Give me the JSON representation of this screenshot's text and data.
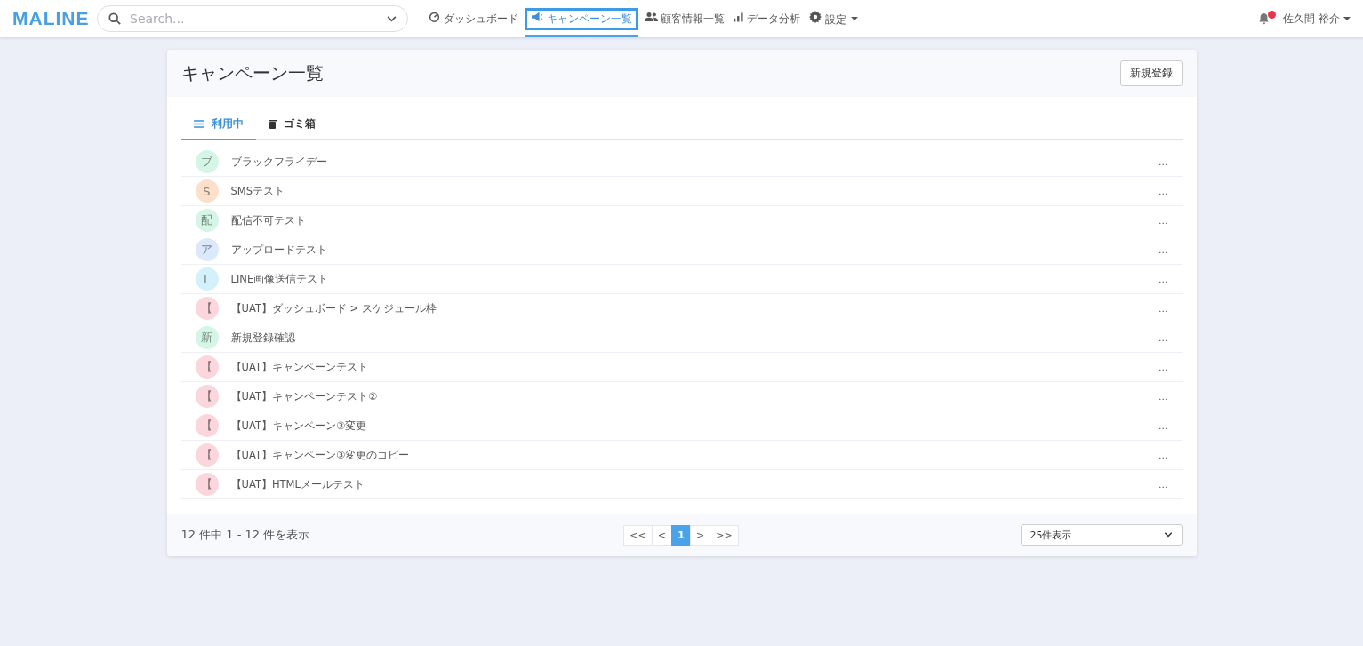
{
  "header": {
    "logo": "MALINE",
    "search": {
      "placeholder": "Search..."
    },
    "nav": [
      {
        "label": "ダッシュボード",
        "selected": false,
        "dropdown": false
      },
      {
        "label": "キャンペーン一覧",
        "selected": true,
        "dropdown": false
      },
      {
        "label": "顧客情報一覧",
        "selected": false,
        "dropdown": false
      },
      {
        "label": "データ分析",
        "selected": false,
        "dropdown": false
      },
      {
        "label": "設定",
        "selected": false,
        "dropdown": true
      }
    ],
    "notification": {
      "unread": true
    },
    "user": "佐久間 裕介"
  },
  "page": {
    "title": "キャンペーン一覧",
    "new_button": "新規登録",
    "tabs": [
      {
        "label": "利用中",
        "selected": true
      },
      {
        "label": "ゴミ箱",
        "selected": false
      }
    ],
    "campaigns": [
      {
        "initial": "ブ",
        "name": "ブラックフライデー",
        "color": "#d5f5e6"
      },
      {
        "initial": "S",
        "name": "SMSテスト",
        "color": "#fde0cc"
      },
      {
        "initial": "配",
        "name": "配信不可テスト",
        "color": "#d5f5e6"
      },
      {
        "initial": "ア",
        "name": "アップロードテスト",
        "color": "#dbe9fb"
      },
      {
        "initial": "L",
        "name": "LINE画像送信テスト",
        "color": "#d4f1fb"
      },
      {
        "initial": "【",
        "name": "【UAT】ダッシュボード > スケジュール枠",
        "color": "#fbd7dd"
      },
      {
        "initial": "新",
        "name": "新規登録確認",
        "color": "#d5f5e6"
      },
      {
        "initial": "【",
        "name": "【UAT】キャンペーンテスト",
        "color": "#fbd7dd"
      },
      {
        "initial": "【",
        "name": "【UAT】キャンペーンテスト②",
        "color": "#fbd7dd"
      },
      {
        "initial": "【",
        "name": "【UAT】キャンペーン③変更",
        "color": "#fbd7dd"
      },
      {
        "initial": "【",
        "name": "【UAT】キャンペーン③変更のコピー",
        "color": "#fbd7dd"
      },
      {
        "initial": "【",
        "name": "【UAT】HTMLメールテスト",
        "color": "#fbd7dd"
      }
    ],
    "row_menu": "...",
    "summary": "12 件中 1 - 12 件を表示",
    "pagination": [
      {
        "label": "<<",
        "selected": false
      },
      {
        "label": "<",
        "selected": false
      },
      {
        "label": "1",
        "selected": true
      },
      {
        "label": ">",
        "selected": false
      },
      {
        "label": ">>",
        "selected": false
      }
    ],
    "page_size": "25件表示"
  }
}
